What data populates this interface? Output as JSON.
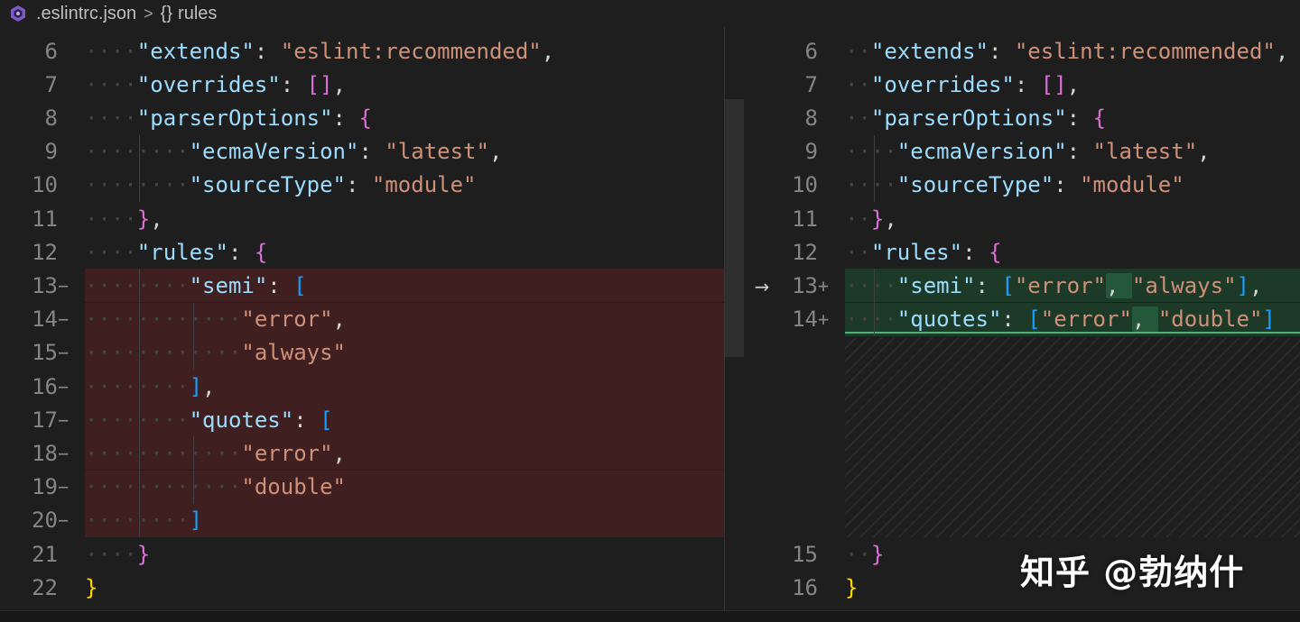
{
  "breadcrumb": {
    "file": ".eslintrc.json",
    "separator": ">",
    "symbol_icon": "{}",
    "symbol": "rules"
  },
  "colors": {
    "deleted_bg": "#3f1f20",
    "inserted_bg": "#1c3a27",
    "inserted_highlight": "#25573a",
    "key": "#9cdcfe",
    "string": "#ce9178",
    "punct": "#d4d4d4",
    "bracket1": "#ffd700",
    "bracket2": "#da70d6",
    "bracket3": "#179fff"
  },
  "left": [
    {
      "num": "6",
      "marker": "",
      "state": "normal",
      "dots": 4,
      "tokens": [
        [
          "k",
          "\"extends\""
        ],
        [
          "p",
          ": "
        ],
        [
          "s",
          "\"eslint:recommended\""
        ],
        [
          "p",
          ","
        ]
      ]
    },
    {
      "num": "7",
      "marker": "",
      "state": "normal",
      "dots": 4,
      "tokens": [
        [
          "k",
          "\"overrides\""
        ],
        [
          "p",
          ": "
        ],
        [
          "b2",
          "[]"
        ],
        [
          "p",
          ","
        ]
      ]
    },
    {
      "num": "8",
      "marker": "",
      "state": "normal",
      "dots": 4,
      "tokens": [
        [
          "k",
          "\"parserOptions\""
        ],
        [
          "p",
          ": "
        ],
        [
          "b2",
          "{"
        ]
      ]
    },
    {
      "num": "9",
      "marker": "",
      "state": "normal",
      "dots": 8,
      "tokens": [
        [
          "k",
          "\"ecmaVersion\""
        ],
        [
          "p",
          ": "
        ],
        [
          "s",
          "\"latest\""
        ],
        [
          "p",
          ","
        ]
      ]
    },
    {
      "num": "10",
      "marker": "",
      "state": "normal",
      "dots": 8,
      "tokens": [
        [
          "k",
          "\"sourceType\""
        ],
        [
          "p",
          ": "
        ],
        [
          "s",
          "\"module\""
        ]
      ]
    },
    {
      "num": "11",
      "marker": "",
      "state": "normal",
      "dots": 4,
      "tokens": [
        [
          "b2",
          "}"
        ],
        [
          "p",
          ","
        ]
      ]
    },
    {
      "num": "12",
      "marker": "",
      "state": "normal",
      "dots": 4,
      "tokens": [
        [
          "k",
          "\"rules\""
        ],
        [
          "p",
          ": "
        ],
        [
          "b2",
          "{"
        ]
      ]
    },
    {
      "num": "13",
      "marker": "−",
      "state": "deleted",
      "dots": 8,
      "tokens": [
        [
          "k",
          "\"semi\""
        ],
        [
          "p",
          ": "
        ],
        [
          "b3",
          "["
        ]
      ]
    },
    {
      "num": "14",
      "marker": "−",
      "state": "deleted",
      "dots": 12,
      "tokens": [
        [
          "s",
          "\"error\""
        ],
        [
          "p",
          ","
        ]
      ]
    },
    {
      "num": "15",
      "marker": "−",
      "state": "deleted",
      "dots": 12,
      "tokens": [
        [
          "s",
          "\"always\""
        ]
      ]
    },
    {
      "num": "16",
      "marker": "−",
      "state": "deleted",
      "dots": 8,
      "tokens": [
        [
          "b3",
          "]"
        ],
        [
          "p",
          ","
        ]
      ]
    },
    {
      "num": "17",
      "marker": "−",
      "state": "deleted",
      "dots": 8,
      "tokens": [
        [
          "k",
          "\"quotes\""
        ],
        [
          "p",
          ": "
        ],
        [
          "b3",
          "["
        ]
      ]
    },
    {
      "num": "18",
      "marker": "−",
      "state": "deleted",
      "dots": 12,
      "tokens": [
        [
          "s",
          "\"error\""
        ],
        [
          "p",
          ","
        ]
      ]
    },
    {
      "num": "19",
      "marker": "−",
      "state": "deleted",
      "dots": 12,
      "tokens": [
        [
          "s",
          "\"double\""
        ]
      ]
    },
    {
      "num": "20",
      "marker": "−",
      "state": "deleted",
      "dots": 8,
      "tokens": [
        [
          "b3",
          "]"
        ]
      ]
    },
    {
      "num": "21",
      "marker": "",
      "state": "normal",
      "dots": 4,
      "tokens": [
        [
          "b2",
          "}"
        ]
      ]
    },
    {
      "num": "22",
      "marker": "",
      "state": "normal",
      "dots": 0,
      "tokens": [
        [
          "b1",
          "}"
        ]
      ]
    }
  ],
  "right": [
    {
      "num": "6",
      "marker": "",
      "state": "normal",
      "dots": 2,
      "tokens": [
        [
          "k",
          "\"extends\""
        ],
        [
          "p",
          ": "
        ],
        [
          "s",
          "\"eslint:recommended\""
        ],
        [
          "p",
          ","
        ]
      ]
    },
    {
      "num": "7",
      "marker": "",
      "state": "normal",
      "dots": 2,
      "tokens": [
        [
          "k",
          "\"overrides\""
        ],
        [
          "p",
          ": "
        ],
        [
          "b2",
          "[]"
        ],
        [
          "p",
          ","
        ]
      ]
    },
    {
      "num": "8",
      "marker": "",
      "state": "normal",
      "dots": 2,
      "tokens": [
        [
          "k",
          "\"parserOptions\""
        ],
        [
          "p",
          ": "
        ],
        [
          "b2",
          "{"
        ]
      ]
    },
    {
      "num": "9",
      "marker": "",
      "state": "normal",
      "dots": 4,
      "tokens": [
        [
          "k",
          "\"ecmaVersion\""
        ],
        [
          "p",
          ": "
        ],
        [
          "s",
          "\"latest\""
        ],
        [
          "p",
          ","
        ]
      ]
    },
    {
      "num": "10",
      "marker": "",
      "state": "normal",
      "dots": 4,
      "tokens": [
        [
          "k",
          "\"sourceType\""
        ],
        [
          "p",
          ": "
        ],
        [
          "s",
          "\"module\""
        ]
      ]
    },
    {
      "num": "11",
      "marker": "",
      "state": "normal",
      "dots": 2,
      "tokens": [
        [
          "b2",
          "}"
        ],
        [
          "p",
          ","
        ]
      ]
    },
    {
      "num": "12",
      "marker": "",
      "state": "normal",
      "dots": 2,
      "tokens": [
        [
          "k",
          "\"rules\""
        ],
        [
          "p",
          ": "
        ],
        [
          "b2",
          "{"
        ]
      ]
    },
    {
      "num": "13",
      "marker": "+",
      "state": "inserted",
      "dots": 4,
      "tokens": [
        [
          "k",
          "\"semi\""
        ],
        [
          "p",
          ": "
        ],
        [
          "b3",
          "["
        ],
        [
          "s",
          "\"error\""
        ],
        [
          "ph",
          ", "
        ],
        [
          "s",
          "\"always\""
        ],
        [
          "b3",
          "]"
        ],
        [
          "p",
          ","
        ]
      ]
    },
    {
      "num": "14",
      "marker": "+",
      "state": "inserted",
      "dots": 4,
      "tokens": [
        [
          "k",
          "\"quotes\""
        ],
        [
          "p",
          ": "
        ],
        [
          "b3",
          "["
        ],
        [
          "s",
          "\"error\""
        ],
        [
          "ph",
          ", "
        ],
        [
          "s",
          "\"double\""
        ],
        [
          "b3",
          "]"
        ]
      ]
    },
    {
      "num": "15",
      "marker": "",
      "state": "normal",
      "dots": 2,
      "tokens": [
        [
          "b2",
          "}"
        ]
      ]
    },
    {
      "num": "16",
      "marker": "",
      "state": "normal",
      "dots": 0,
      "tokens": [
        [
          "b1",
          "}"
        ]
      ]
    }
  ],
  "diff_arrow": "→",
  "watermark": "知乎 @勃纳什"
}
